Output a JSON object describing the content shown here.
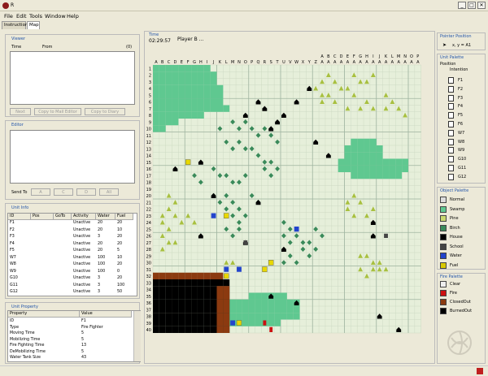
{
  "window": {
    "title": "R",
    "min": "_",
    "max": "□",
    "close": "✕"
  },
  "menu": [
    "File",
    "Edit",
    "Tools",
    "Window",
    "Help"
  ],
  "tabs": [
    "Instructions",
    "Map"
  ],
  "viewer": {
    "title": "Viewer",
    "col_time": "Time",
    "col_from": "From",
    "count": "(0)",
    "buttons": [
      "Next",
      "Copy to Mail Editor",
      "Copy to Diary"
    ]
  },
  "editor": {
    "title": "Editor",
    "send_to": "Send To",
    "targets": [
      "A",
      "C",
      "D",
      "All"
    ]
  },
  "unit_info": {
    "title": "Unit Info",
    "columns": [
      "ID",
      "Pos",
      "GoTo",
      "Activity",
      "Water",
      "Fuel"
    ],
    "rows": [
      [
        "F1",
        "",
        "",
        "Unactive",
        "20",
        "20"
      ],
      [
        "F2",
        "",
        "",
        "Unactive",
        "20",
        "10"
      ],
      [
        "F3",
        "",
        "",
        "Unactive",
        "3",
        "20"
      ],
      [
        "F4",
        "",
        "",
        "Unactive",
        "20",
        "20"
      ],
      [
        "F5",
        "",
        "",
        "Unactive",
        "20",
        "5"
      ],
      [
        "W7",
        "",
        "",
        "Unactive",
        "100",
        "10"
      ],
      [
        "W8",
        "",
        "",
        "Unactive",
        "100",
        "20"
      ],
      [
        "W9",
        "",
        "",
        "Unactive",
        "100",
        "0"
      ],
      [
        "G10",
        "",
        "",
        "Unactive",
        "3",
        "20"
      ],
      [
        "G11",
        "",
        "",
        "Unactive",
        "3",
        "100"
      ],
      [
        "G12",
        "",
        "",
        "Unactive",
        "3",
        "50"
      ]
    ]
  },
  "unit_property": {
    "title": "Unit Property",
    "columns": [
      "Property",
      "Value"
    ],
    "rows": [
      [
        "ID",
        "F1"
      ],
      [
        "Type",
        "Fire Fighter"
      ],
      [
        "Moving Time",
        "5"
      ],
      [
        "Mobilizing Time",
        "5"
      ],
      [
        "Fire Fighting Time",
        "13"
      ],
      [
        "DeMobilizing Time",
        "5"
      ],
      [
        "Water Tank Size",
        "43"
      ]
    ]
  },
  "map": {
    "time_label": "Time",
    "time": "02:29:57",
    "player": "Player B ...",
    "cols": [
      "A",
      "B",
      "C",
      "D",
      "E",
      "F",
      "G",
      "H",
      "I",
      "J",
      "K",
      "L",
      "M",
      "N",
      "O",
      "P",
      "Q",
      "R",
      "S",
      "T",
      "U",
      "V",
      "W",
      "X",
      "Y",
      "Z",
      "A",
      "A",
      "A",
      "A",
      "A",
      "A",
      "A",
      "A",
      "A",
      "A",
      "A",
      "A",
      "A",
      "A",
      "A",
      "A"
    ],
    "cols2": [
      "",
      "",
      "",
      "",
      "",
      "",
      "",
      "",
      "",
      "",
      "",
      "",
      "",
      "",
      "",
      "",
      "",
      "",
      "",
      "",
      "",
      "",
      "",
      "",
      "",
      "",
      "A",
      "B",
      "C",
      "D",
      "E",
      "F",
      "G",
      "H",
      "I",
      "J",
      "K",
      "L",
      "M",
      "N",
      "O",
      "P"
    ],
    "rows": [
      "1",
      "2",
      "3",
      "4",
      "5",
      "6",
      "7",
      "8",
      "9",
      "10",
      "11",
      "12",
      "13",
      "14",
      "15",
      "16",
      "17",
      "18",
      "19",
      "20",
      "21",
      "22",
      "23",
      "24",
      "25",
      "26",
      "27",
      "28",
      "29",
      "30",
      "31",
      "32",
      "33",
      "34",
      "35",
      "36",
      "37",
      "38",
      "39",
      "40"
    ]
  },
  "pointer": {
    "title": "Pointer Position",
    "coord": "x, y = A1"
  },
  "unit_palette": {
    "title": "Unit Palette",
    "position": "Position",
    "intention": "Intention",
    "items": [
      "F1",
      "F2",
      "F3",
      "F4",
      "F5",
      "F6",
      "W7",
      "W8",
      "W9",
      "G10",
      "G11",
      "G12"
    ]
  },
  "object_palette": {
    "title": "Object Palette",
    "items": [
      {
        "label": "Normal",
        "color": "#dcdcdc"
      },
      {
        "label": "Swamp",
        "color": "#5fc890"
      },
      {
        "label": "Pine",
        "color": "#c8d870"
      },
      {
        "label": "Birch",
        "color": "#3a8a5a"
      },
      {
        "label": "House",
        "color": "#000000"
      },
      {
        "label": "School",
        "color": "#444444"
      },
      {
        "label": "Water",
        "color": "#2244cc"
      },
      {
        "label": "Fuel",
        "color": "#d8c800"
      }
    ]
  },
  "fire_palette": {
    "title": "Fire Palette",
    "items": [
      {
        "label": "Clear",
        "color": "#eeeeee"
      },
      {
        "label": "Fire",
        "color": "#cc1010"
      },
      {
        "label": "ClosedOut",
        "color": "#8b3a10"
      },
      {
        "label": "BurnedOut",
        "color": "#000000"
      }
    ]
  }
}
